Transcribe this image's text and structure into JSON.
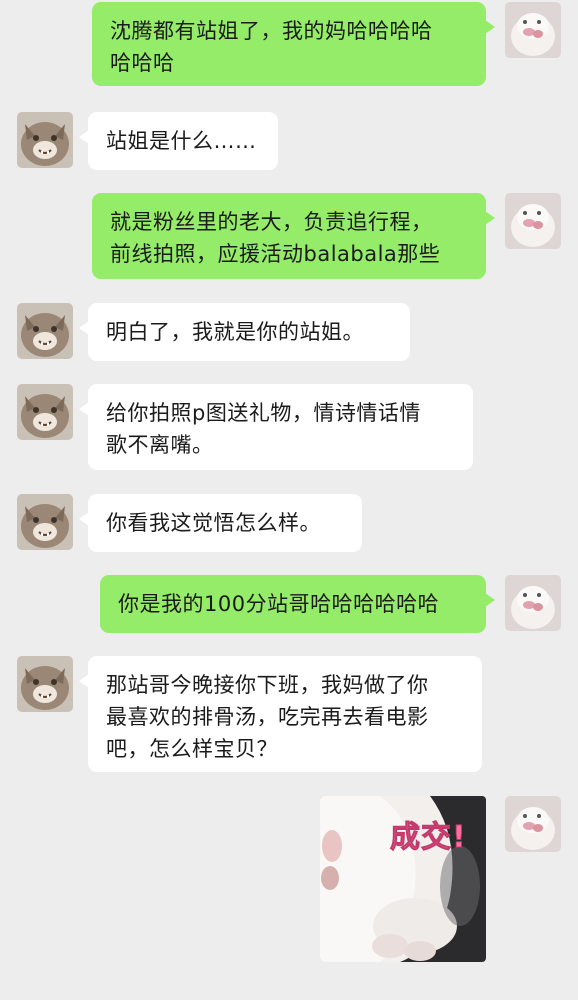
{
  "messages": [
    {
      "side": "sent",
      "lines": [
        "沈腾都有站姐了，我的妈哈哈哈哈",
        "哈哈哈"
      ]
    },
    {
      "side": "recv",
      "lines": [
        "站姐是什么……"
      ]
    },
    {
      "side": "sent",
      "lines": [
        "就是粉丝里的老大，负责追行程，",
        "前线拍照，应援活动balabala那些"
      ]
    },
    {
      "side": "recv",
      "lines": [
        "明白了，我就是你的站姐。"
      ]
    },
    {
      "side": "recv",
      "lines": [
        "给你拍照p图送礼物，情诗情话情",
        "歌不离嘴。"
      ]
    },
    {
      "side": "recv",
      "lines": [
        "你看我这觉悟怎么样。"
      ]
    },
    {
      "side": "sent",
      "lines": [
        "你是我的100分站哥哈哈哈哈哈哈"
      ]
    },
    {
      "side": "recv",
      "lines": [
        "那站哥今晚接你下班，我妈做了你",
        "最喜欢的排骨汤，吃完再去看电影",
        "吧，怎么样宝贝？"
      ]
    }
  ],
  "sticker": {
    "text": "成交!"
  },
  "avatars": {
    "me": "white-cat-avatar-icon",
    "friend": "tabby-cat-avatar-icon"
  },
  "colors": {
    "background": "#ededed",
    "sent_bubble": "#95ec69",
    "recv_bubble": "#ffffff"
  }
}
